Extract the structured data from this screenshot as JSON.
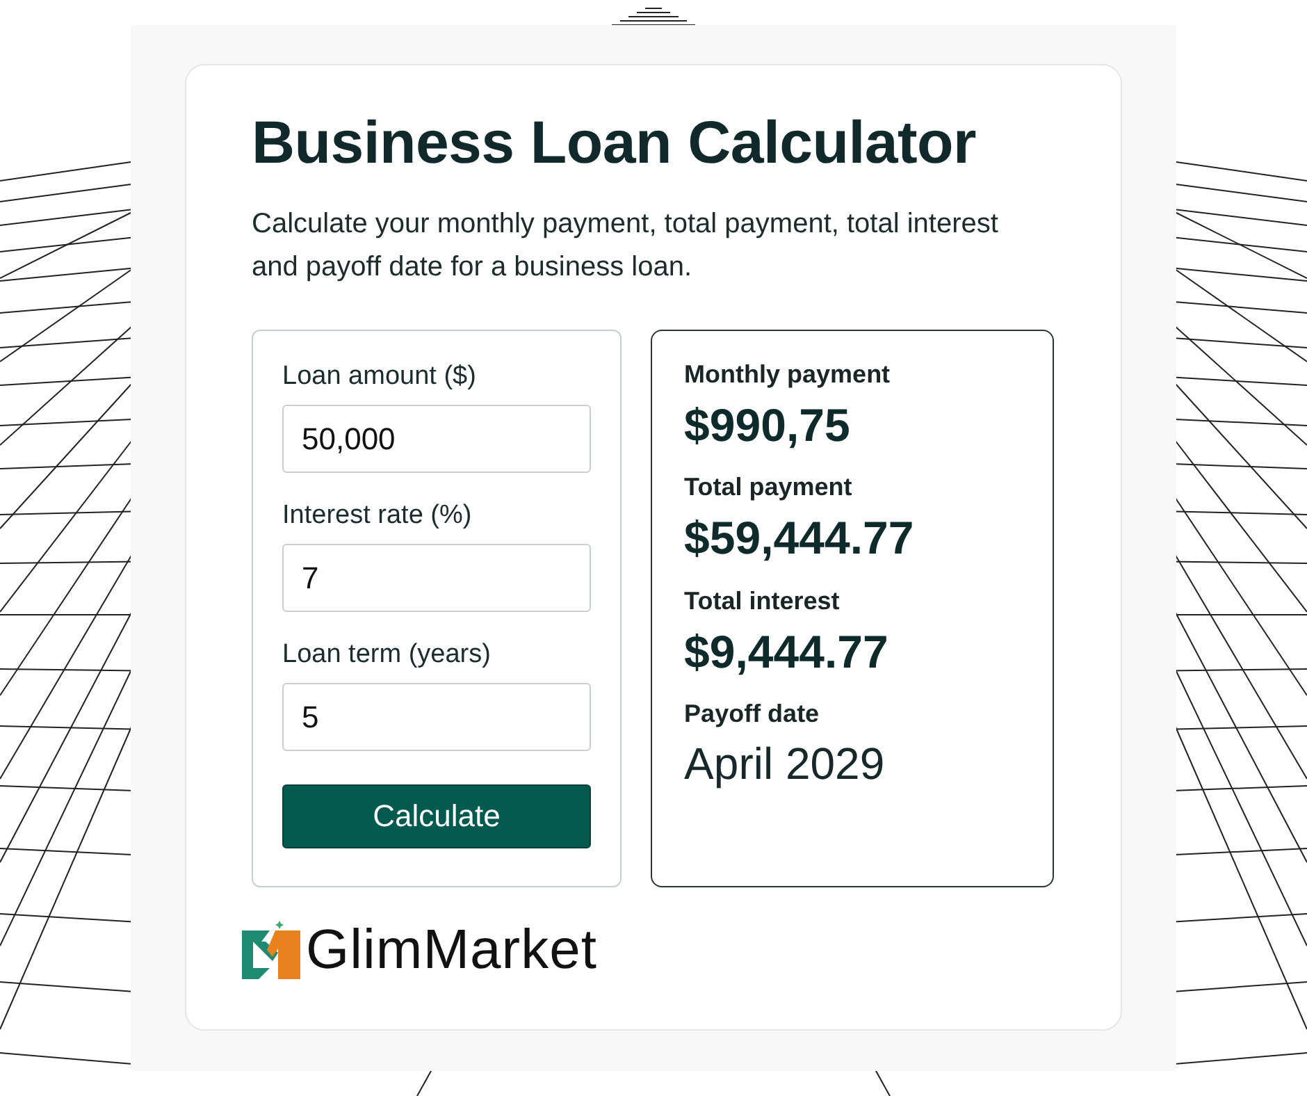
{
  "title": "Business Loan Calculator",
  "description": "Calculate your monthly payment, total payment, total interest and payoff date for a business loan.",
  "form": {
    "fields": [
      {
        "label": "Loan amount ($)",
        "value": "50,000"
      },
      {
        "label": "Interest rate (%)",
        "value": "7"
      },
      {
        "label": "Loan term (years)",
        "value": "5"
      }
    ],
    "button": "Calculate"
  },
  "results": [
    {
      "label": "Monthly payment",
      "value": "$990,75",
      "kind": "amount"
    },
    {
      "label": "Total payment",
      "value": "$59,444.77",
      "kind": "amount"
    },
    {
      "label": "Total interest",
      "value": "$9,444.77",
      "kind": "amount"
    },
    {
      "label": "Payoff date",
      "value": "April 2029",
      "kind": "date"
    }
  ],
  "logo": {
    "text": "GlimMarket"
  }
}
